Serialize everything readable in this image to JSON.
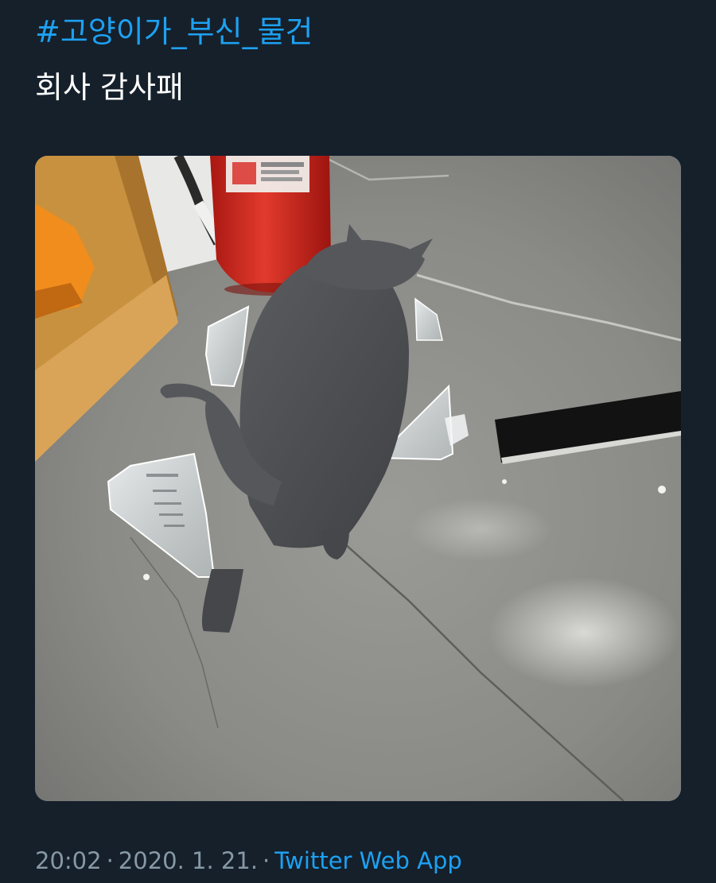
{
  "tweet": {
    "hashtag": "#고양이가_부신_물건",
    "text": "회사 감사패",
    "time": "20:02",
    "separator": "·",
    "date": "2020. 1. 21.",
    "source": "Twitter Web App"
  },
  "media": {
    "alt": "Photo of a gray cat walking among broken glass plaque pieces on a concrete floor",
    "icons": [
      "photo-media"
    ],
    "colors": {
      "floor": "#8c8c88",
      "cat": "#4f5155",
      "extinguisher": "#d8271f",
      "shelf": "#c8913f"
    }
  },
  "colors": {
    "background": "#15202b",
    "link": "#1da1f2",
    "text": "#ffffff",
    "secondary": "#8899a6"
  }
}
